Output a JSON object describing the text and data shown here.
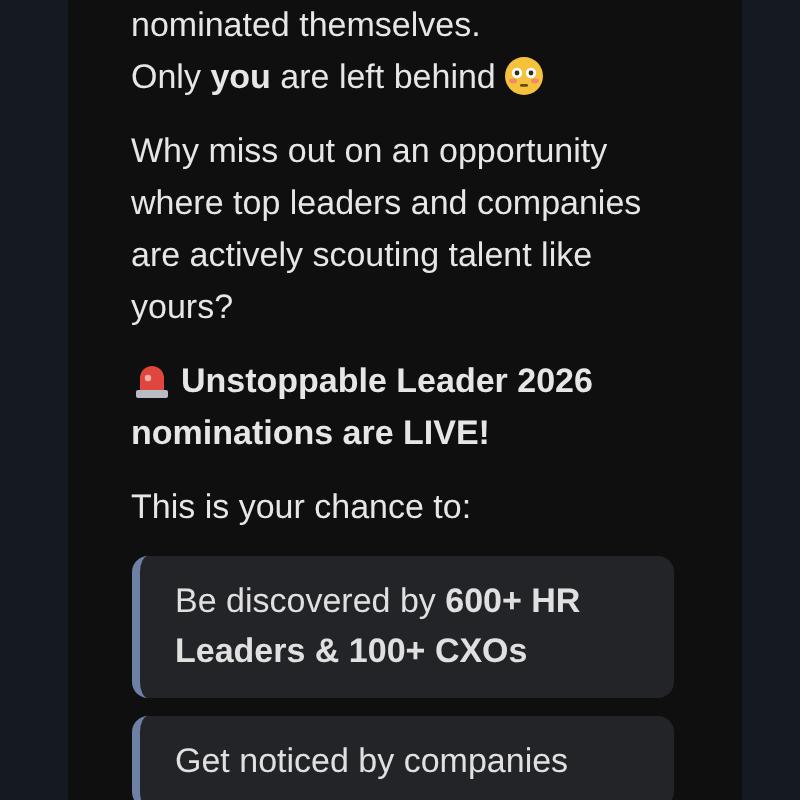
{
  "message": {
    "paragraphs": [
      {
        "kind": "text",
        "lines": [
          "nominated themselves.",
          "Only **you** are left behind"
        ],
        "emoji": {
          "kind": "flushed"
        }
      },
      {
        "kind": "text",
        "lines": [
          "Why miss out on an opportunity where top leaders and companies are actively scouting talent like yours?"
        ]
      },
      {
        "kind": "heading",
        "lines": [
          "Unstoppable Leader 2026 nominations are LIVE!"
        ],
        "emoji": {
          "kind": "siren"
        }
      },
      {
        "kind": "text",
        "lines": [
          "This is your chance to:"
        ]
      }
    ],
    "highlights": [
      {
        "text": "Be discovered by **600+ HR Leaders & 100+ CXOs**"
      },
      {
        "text": "Get noticed by companies"
      }
    ]
  }
}
